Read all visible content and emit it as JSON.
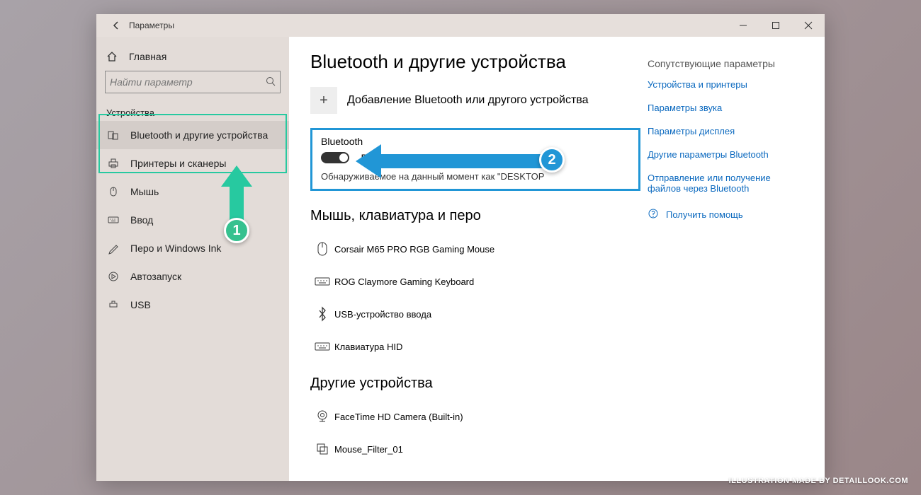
{
  "window": {
    "title": "Параметры"
  },
  "sidebar": {
    "home": "Главная",
    "search_placeholder": "Найти параметр",
    "category": "Устройства",
    "items": [
      {
        "label": "Bluetooth и другие устройства"
      },
      {
        "label": "Принтеры и сканеры"
      },
      {
        "label": "Мышь"
      },
      {
        "label": "Ввод"
      },
      {
        "label": "Перо и Windows Ink"
      },
      {
        "label": "Автозапуск"
      },
      {
        "label": "USB"
      }
    ]
  },
  "page": {
    "heading": "Bluetooth и другие устройства",
    "add_device": "Добавление Bluetooth или другого устройства",
    "bt_label": "Bluetooth",
    "bt_state": "Вкл.",
    "discoverable": "Обнаруживаемое на данный момент как \"DESKTOP",
    "section_mkp": "Мышь, клавиатура и перо",
    "devices_mkp": [
      "Corsair M65 PRO RGB Gaming Mouse",
      "ROG Claymore Gaming Keyboard",
      "USB-устройство ввода",
      "Клавиатура HID"
    ],
    "section_other": "Другие устройства",
    "devices_other": [
      "FaceTime HD Camera (Built-in)",
      "Mouse_Filter_01"
    ]
  },
  "related": {
    "heading": "Сопутствующие параметры",
    "links": [
      "Устройства и принтеры",
      "Параметры звука",
      "Параметры дисплея",
      "Другие параметры Bluetooth",
      "Отправление или получение файлов через Bluetooth"
    ],
    "help": "Получить помощь"
  },
  "annotations": {
    "step1": "1",
    "step2": "2"
  },
  "watermark": "ILLUSTRATION MADE BY DETAILLOOK.COM"
}
